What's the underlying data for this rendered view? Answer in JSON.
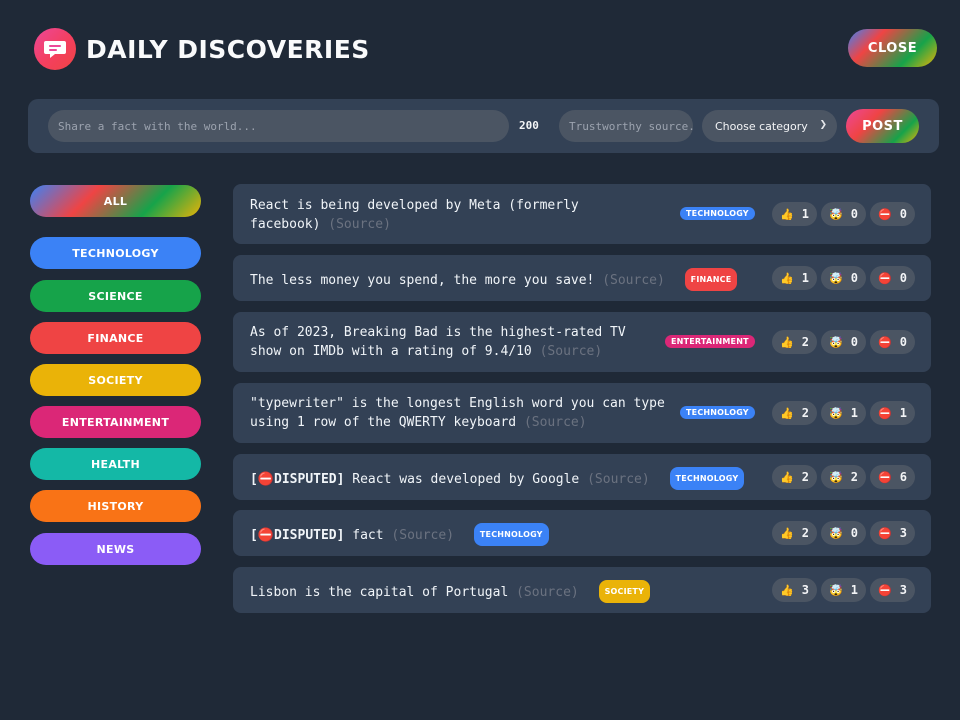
{
  "app": {
    "title": "Daily Discoveries",
    "close_label": "Close"
  },
  "form": {
    "fact_placeholder": "Share a fact with the world...",
    "char_count": "200",
    "source_placeholder": "Trustworthy source...",
    "category_selected": "Choose category",
    "post_label": "Post"
  },
  "categories": [
    {
      "label": "All",
      "color": "gradient"
    },
    {
      "label": "Technology",
      "color": "#3b82f6"
    },
    {
      "label": "Science",
      "color": "#16a34a"
    },
    {
      "label": "Finance",
      "color": "#ef4444"
    },
    {
      "label": "Society",
      "color": "#eab308"
    },
    {
      "label": "Entertainment",
      "color": "#db2777"
    },
    {
      "label": "Health",
      "color": "#14b8a6"
    },
    {
      "label": "History",
      "color": "#f97316"
    },
    {
      "label": "News",
      "color": "#8b5cf6"
    }
  ],
  "facts": [
    {
      "text": "React is being developed by Meta (formerly facebook)",
      "source": "(Source)",
      "disputed": false,
      "tag": "Technology",
      "tag_color": "#3b82f6",
      "interesting": "1",
      "mindblowing": "0",
      "false": "0"
    },
    {
      "text": "The less money you spend, the more you save!",
      "source": "(Source)",
      "disputed": false,
      "tag": "Finance",
      "tag_color": "#ef4444",
      "interesting": "1",
      "mindblowing": "0",
      "false": "0"
    },
    {
      "text": "As of 2023, Breaking Bad is the highest-rated TV show on IMDb with a rating of 9.4/10",
      "source": "(Source)",
      "disputed": false,
      "tag": "Entertainment",
      "tag_color": "#db2777",
      "interesting": "2",
      "mindblowing": "0",
      "false": "0"
    },
    {
      "text": "\"typewriter\" is the longest English word you can type using 1 row of the QWERTY keyboard",
      "source": "(Source)",
      "disputed": false,
      "tag": "Technology",
      "tag_color": "#3b82f6",
      "interesting": "2",
      "mindblowing": "1",
      "false": "1"
    },
    {
      "text": "React was developed by Google",
      "source": "(Source)",
      "disputed": true,
      "disputed_label": "[⛔DISPUTED]",
      "tag": "Technology",
      "tag_color": "#3b82f6",
      "interesting": "2",
      "mindblowing": "2",
      "false": "6"
    },
    {
      "text": "fact",
      "source": "(Source)",
      "disputed": true,
      "disputed_label": "[⛔DISPUTED]",
      "tag": "Technology",
      "tag_color": "#3b82f6",
      "interesting": "2",
      "mindblowing": "0",
      "false": "3"
    },
    {
      "text": "Lisbon is the capital of Portugal",
      "source": "(Source)",
      "disputed": false,
      "tag": "Society",
      "tag_color": "#eab308",
      "interesting": "3",
      "mindblowing": "1",
      "false": "3"
    }
  ],
  "vote_icons": {
    "interesting": "thumbs-up-icon",
    "mindblowing": "mind-blown-icon",
    "false": "no-entry-icon"
  }
}
